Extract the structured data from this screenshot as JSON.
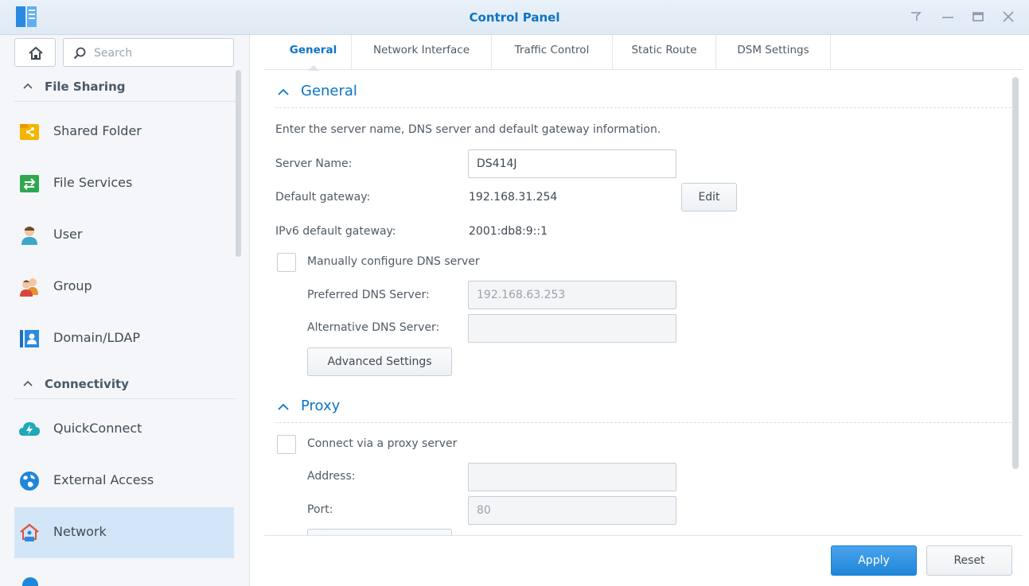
{
  "window": {
    "title": "Control Panel",
    "controls": [
      "pin-icon",
      "minimize-icon",
      "maximize-icon",
      "close-icon"
    ]
  },
  "sidebar": {
    "search_placeholder": "Search",
    "groups": [
      {
        "label": "File Sharing",
        "items": [
          {
            "label": "Shared Folder",
            "icon": "shared-folder-icon"
          },
          {
            "label": "File Services",
            "icon": "file-services-icon"
          },
          {
            "label": "User",
            "icon": "user-icon"
          },
          {
            "label": "Group",
            "icon": "group-icon"
          },
          {
            "label": "Domain/LDAP",
            "icon": "domain-ldap-icon"
          }
        ]
      },
      {
        "label": "Connectivity",
        "items": [
          {
            "label": "QuickConnect",
            "icon": "quickconnect-icon"
          },
          {
            "label": "External Access",
            "icon": "external-access-icon"
          },
          {
            "label": "Network",
            "icon": "network-icon",
            "active": true
          }
        ]
      }
    ]
  },
  "tabs": [
    "General",
    "Network Interface",
    "Traffic Control",
    "Static Route",
    "DSM Settings"
  ],
  "general": {
    "section_title": "General",
    "description": "Enter the server name, DNS server and default gateway information.",
    "server_name_label": "Server Name:",
    "server_name_value": "DS414J",
    "default_gateway_label": "Default gateway:",
    "default_gateway_value": "192.168.31.254",
    "edit_label": "Edit",
    "ipv6_gateway_label": "IPv6 default gateway:",
    "ipv6_gateway_value": "2001:db8:9::1",
    "manual_dns_label": "Manually configure DNS server",
    "preferred_dns_label": "Preferred DNS Server:",
    "preferred_dns_value": "192.168.63.253",
    "alternative_dns_label": "Alternative DNS Server:",
    "alternative_dns_value": "",
    "advanced_settings_label": "Advanced Settings"
  },
  "proxy": {
    "section_title": "Proxy",
    "connect_label": "Connect via a proxy server",
    "address_label": "Address:",
    "address_value": "",
    "port_label": "Port:",
    "port_value": "80"
  },
  "footer": {
    "apply_label": "Apply",
    "reset_label": "Reset"
  },
  "colors": {
    "accent": "#0c74c5",
    "apply_button": "#1f86d9",
    "active_nav": "#d2e6f8"
  }
}
